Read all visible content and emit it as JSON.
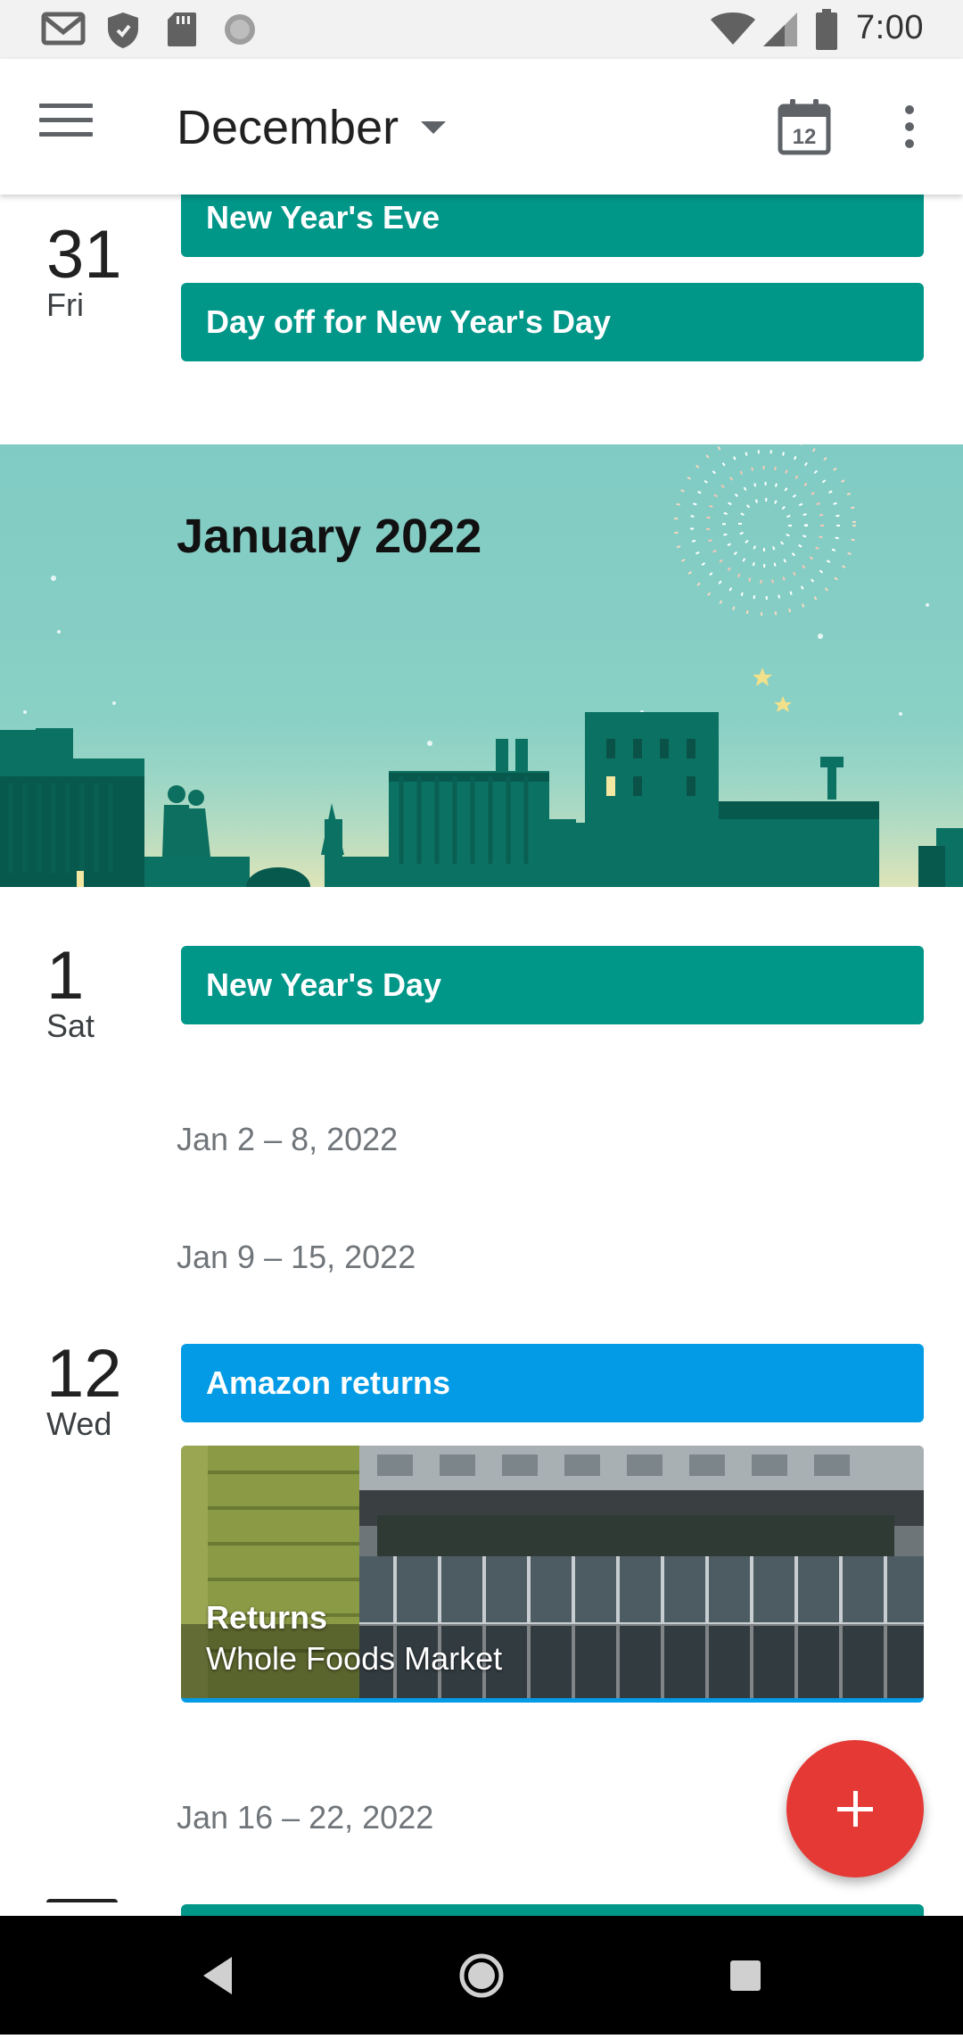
{
  "status_bar": {
    "time": "7:00",
    "left_icons": [
      "gmail-icon",
      "shield-icon",
      "sd-card-icon",
      "loading-icon"
    ],
    "right_icons": [
      "wifi-icon",
      "cell-signal-icon",
      "battery-icon"
    ]
  },
  "app_bar": {
    "title": "December",
    "today_day": "12",
    "icons": [
      "menu-icon",
      "dropdown-caret-icon",
      "calendar-today-icon",
      "more-vert-icon"
    ]
  },
  "colors": {
    "holiday": "#009688",
    "personal": "#039be5",
    "fab": "#e53935",
    "banner": "#80cbc4"
  },
  "days": [
    {
      "num": "31",
      "dow": "Fri",
      "events": [
        "New Year's Eve",
        "Day off for New Year's Day"
      ]
    }
  ],
  "month_banner": {
    "title": "January 2022"
  },
  "day_jan1": {
    "num": "1",
    "dow": "Sat",
    "event": "New Year's Day"
  },
  "week_ranges": [
    "Jan 2 – 8, 2022",
    "Jan 9 – 15, 2022",
    "Jan 16 – 22, 2022"
  ],
  "day_jan12": {
    "num": "12",
    "dow": "Wed",
    "event": "Amazon returns",
    "photo_event": {
      "title": "Returns",
      "location": "Whole Foods Market"
    }
  },
  "fab": {
    "icon": "plus-icon"
  },
  "nav_bar": {
    "icons": [
      "back-icon",
      "home-icon",
      "recents-icon"
    ]
  }
}
